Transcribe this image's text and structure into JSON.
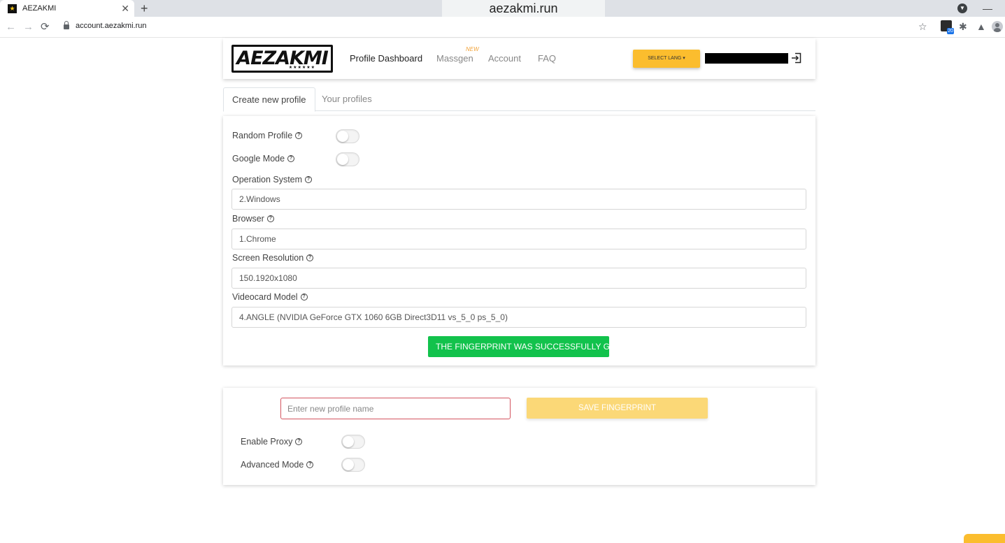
{
  "browser": {
    "tab_title": "AEZAKMI",
    "window_title": "aezakmi.run",
    "url": "account.aezakmi.run",
    "extension_badge": "20"
  },
  "header": {
    "logo_text": "AEZAKMI",
    "logo_stars": "★★★★★★",
    "nav": {
      "profile_dashboard": "Profile Dashboard",
      "massgen": "Massgen",
      "massgen_badge": "NEW",
      "account": "Account",
      "faq": "FAQ"
    },
    "select_lang": "SELECT LANG ▾"
  },
  "tabs": {
    "create": "Create new profile",
    "yours": "Your profiles"
  },
  "form": {
    "random_profile": "Random Profile",
    "google_mode": "Google Mode",
    "os_label": "Operation System",
    "os_value": "2.Windows",
    "browser_label": "Browser",
    "browser_value": "1.Chrome",
    "resolution_label": "Screen Resolution",
    "resolution_value": "150.1920x1080",
    "videocard_label": "Videocard Model",
    "videocard_value": "4.ANGLE (NVIDIA GeForce GTX 1060 6GB Direct3D11 vs_5_0 ps_5_0)",
    "success_message": "THE FINGERPRINT WAS SUCCESSFULLY GENERATED"
  },
  "save": {
    "name_placeholder": "Enter new profile name",
    "save_label": "SAVE FINGERPRINT",
    "enable_proxy": "Enable Proxy",
    "advanced_mode": "Advanced Mode"
  },
  "colors": {
    "accent": "#fbbd2e",
    "success": "#12c24c",
    "input_error_border": "#d3545f"
  }
}
